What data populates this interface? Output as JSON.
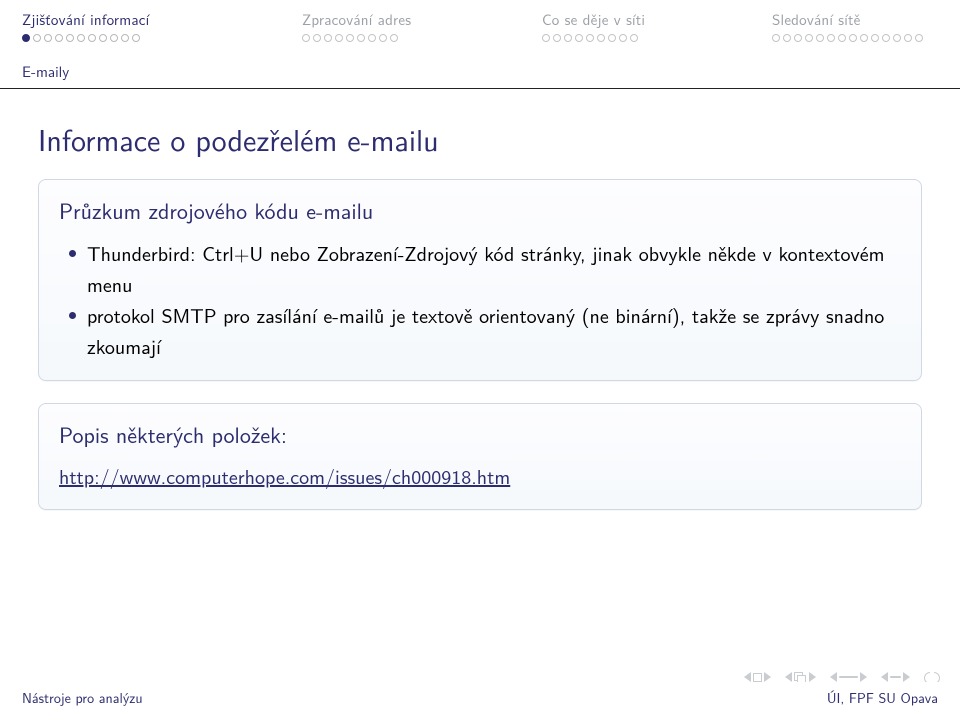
{
  "nav": {
    "sections": [
      {
        "label": "Zjišťování informací",
        "active": true,
        "dots": 11,
        "current": 0
      },
      {
        "label": "Zpracování adres",
        "active": false,
        "dots": 9
      },
      {
        "label": "Co se děje v síti",
        "active": false,
        "dots": 9
      },
      {
        "label": "Sledování sítě",
        "active": false,
        "dots": 14
      }
    ],
    "subsection": "E-maily"
  },
  "title": "Informace o podezřelém e-mailu",
  "block1": {
    "title": "Průzkum zdrojového kódu e-mailu",
    "items": [
      "Thunderbird: Ctrl+U nebo Zobrazení-Zdrojový kód stránky, jinak obvykle někde v kontextovém menu",
      "protokol SMTP pro zasílání e-mailů je textově orientovaný (ne binární), takže se zprávy snadno zkoumají"
    ]
  },
  "block2": {
    "title": "Popis některých položek:",
    "link": "http://www.computerhope.com/issues/ch000918.htm"
  },
  "footer": {
    "left": "Nástroje pro analýzu",
    "right": "ÚI, FPF SU Opava"
  }
}
